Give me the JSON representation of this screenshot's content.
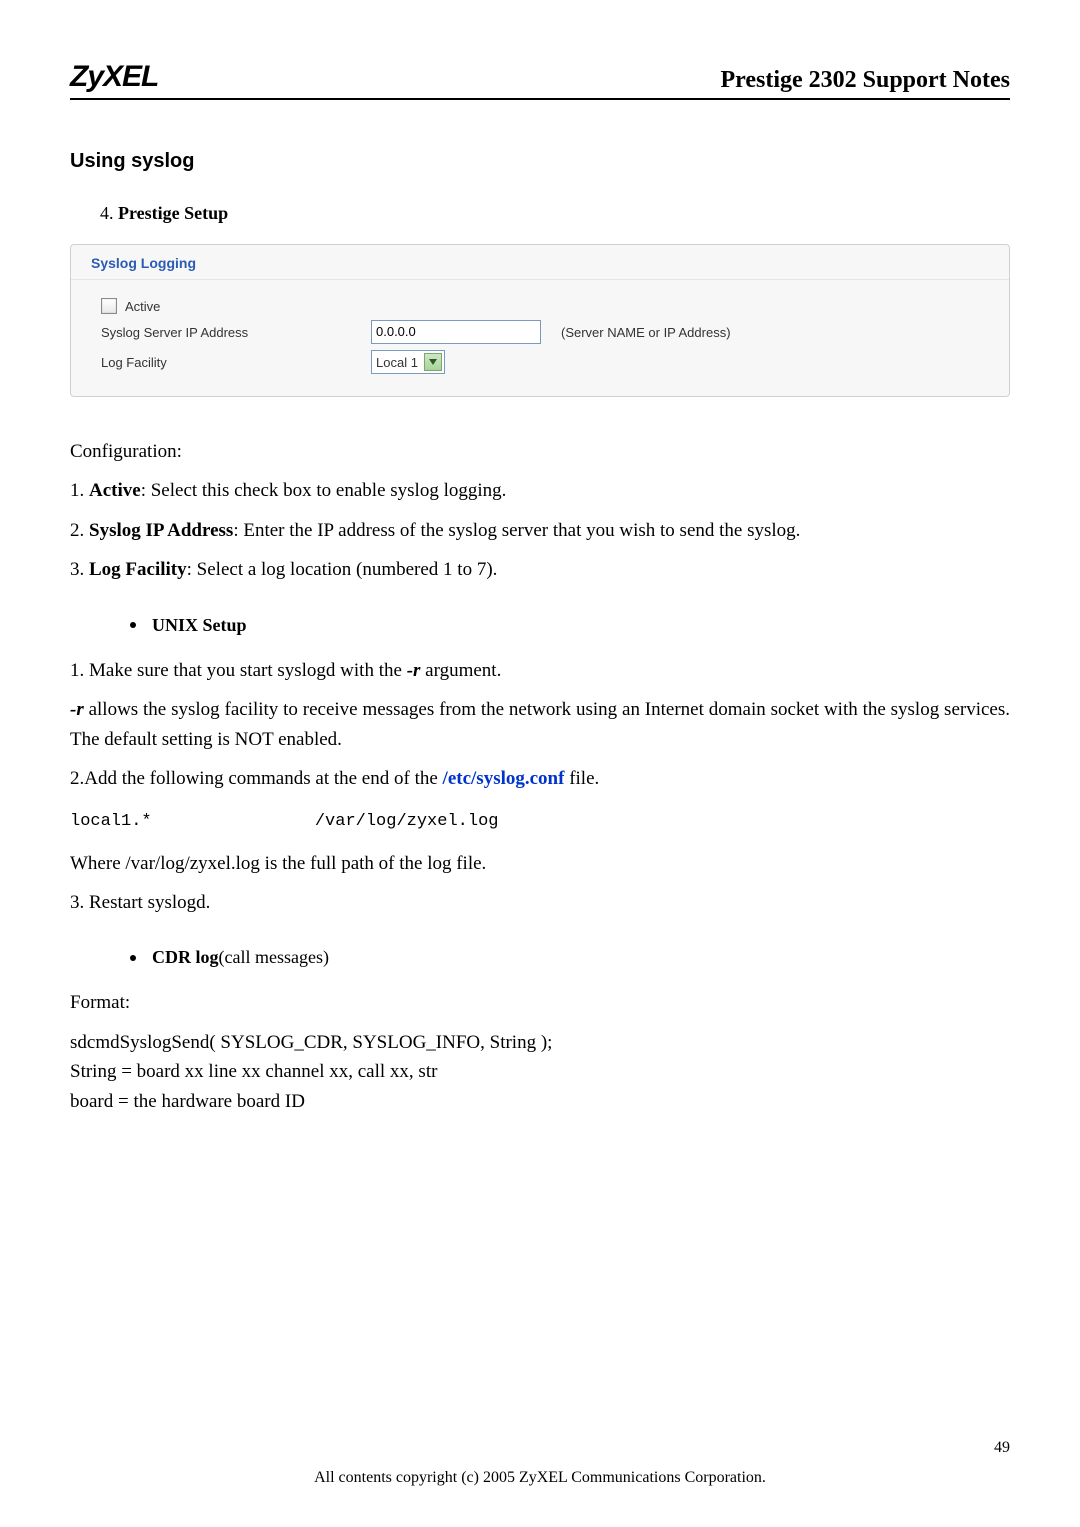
{
  "header": {
    "logo": "ZyXEL",
    "title": "Prestige 2302 Support Notes"
  },
  "section_title": "Using syslog",
  "ordered_item": {
    "number": "4.",
    "label": "Prestige Setup"
  },
  "panel": {
    "title": "Syslog Logging",
    "active_label": "Active",
    "server_ip_label": "Syslog Server IP Address",
    "server_ip_value": "0.0.0.0",
    "server_ip_hint": "(Server NAME or IP Address)",
    "log_facility_label": "Log Facility",
    "log_facility_value": "Local 1"
  },
  "config_heading": "Configuration:",
  "config_items": {
    "1": {
      "num": "1. ",
      "term": "Active",
      "rest": ": Select this check box to enable syslog logging."
    },
    "2": {
      "num": "2. ",
      "term": "Syslog IP Address",
      "rest": ": Enter the IP address of the syslog server that you wish to send the syslog."
    },
    "3": {
      "num": "3. ",
      "term": "Log Facility",
      "rest": ": Select a log location (numbered 1 to 7)."
    }
  },
  "unix_bullet": "UNIX Setup",
  "unix": {
    "line1_a": "1. Make sure that you start syslogd with the ",
    "line1_b": "-r",
    "line1_c": " argument.",
    "para_a": "-r",
    "para_b": " allows the syslog facility to receive messages from the network using an Internet domain socket with the syslog services. The default setting is NOT enabled.",
    "line2_a": "2.Add the following commands at the end of the ",
    "line2_link": "/etc/syslog.conf",
    "line2_b": " file.",
    "code": "local1.*                /var/log/zyxel.log",
    "where": "Where /var/log/zyxel.log is the full path of the log file.",
    "line3": "3. Restart syslogd."
  },
  "cdr_bullet": {
    "bold": "CDR log",
    "rest": "(call messages)"
  },
  "format_label": "Format:",
  "format_lines": {
    "a": "sdcmdSyslogSend( SYSLOG_CDR, SYSLOG_INFO, String );",
    "b": "String = board xx line xx channel xx, call xx, str",
    "c": "board = the hardware board ID"
  },
  "page_number": "49",
  "footer": "All contents copyright (c) 2005 ZyXEL Communications Corporation."
}
